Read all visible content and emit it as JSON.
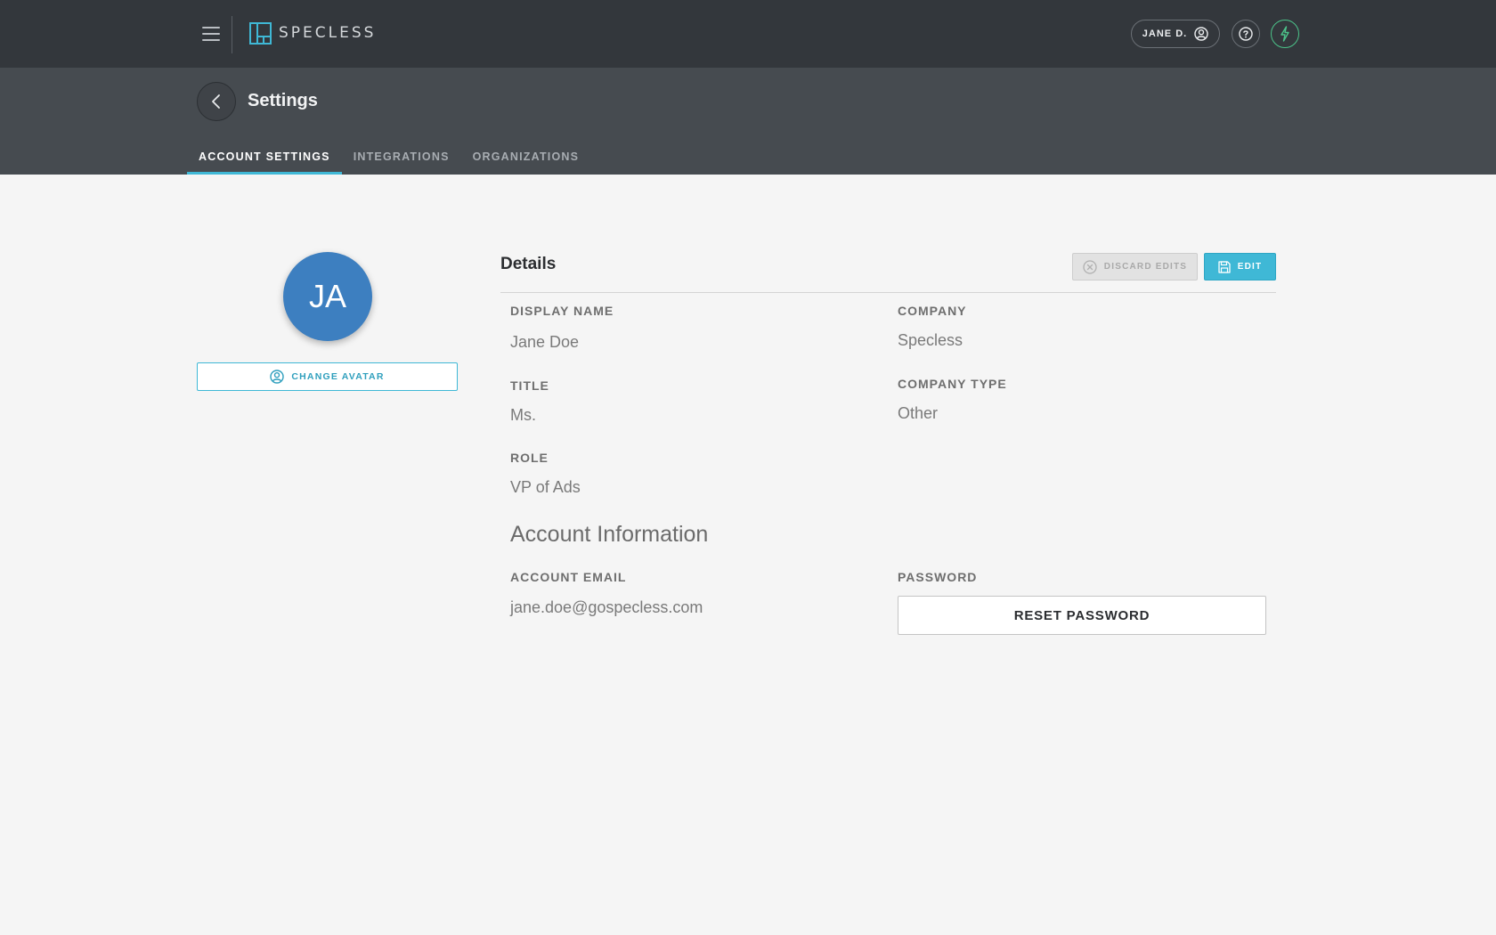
{
  "app": {
    "brand": "SPECLESS"
  },
  "topbar": {
    "user_label": "JANE D.",
    "icons": {
      "menu": "hamburger-menu-icon",
      "user": "user-circle-icon",
      "help": "question-circle-icon",
      "power": "lightning-bolt-icon"
    }
  },
  "page": {
    "title": "Settings",
    "tabs": [
      {
        "label": "ACCOUNT SETTINGS",
        "active": true
      },
      {
        "label": "INTEGRATIONS",
        "active": false
      },
      {
        "label": "ORGANIZATIONS",
        "active": false
      }
    ]
  },
  "avatar": {
    "initials": "JA",
    "change_label": "CHANGE AVATAR",
    "color": "#3d7fc0"
  },
  "details": {
    "title": "Details",
    "discard_label": "DISCARD EDITS",
    "edit_label": "EDIT",
    "fields": {
      "display_name": {
        "label": "DISPLAY NAME",
        "value": "Jane Doe"
      },
      "company": {
        "label": "COMPANY",
        "value": "Specless"
      },
      "title": {
        "label": "TITLE",
        "value": "Ms."
      },
      "company_type": {
        "label": "COMPANY TYPE",
        "value": "Other"
      },
      "role": {
        "label": "ROLE",
        "value": "VP of Ads"
      }
    }
  },
  "account": {
    "title": "Account Information",
    "email_label": "ACCOUNT EMAIL",
    "email_value": "jane.doe@gospecless.com",
    "password_label": "PASSWORD",
    "reset_label": "RESET PASSWORD"
  },
  "colors": {
    "accent": "#3fb8d6",
    "topbar": "#33373c",
    "subheader": "#464b50",
    "success": "#4cc38a"
  }
}
